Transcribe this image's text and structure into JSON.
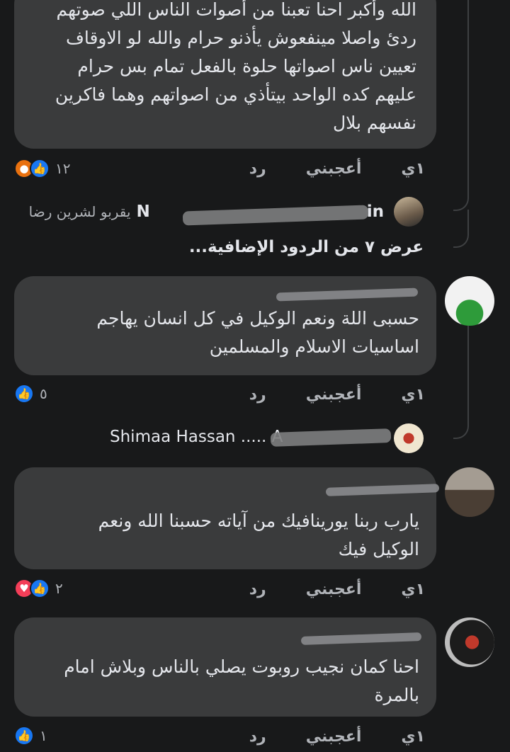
{
  "comments": [
    {
      "text": "الله وأكبر احنا تعبنا من أصوات الناس اللي صوتهم\nردئ واصلا مينفعوش يأذنو حرام والله لو الاوقاف\nتعيين ناس اصواتها حلوة بالفعل تمام بس حرام\nعليهم كده الواحد بيتأذي من اصواتهم وهما فاكرين\nنفسهم بلال",
      "time": "١ي",
      "like": "أعجبني",
      "reply": "رد",
      "reactions": [
        "angry",
        "like"
      ],
      "count": "١٢"
    },
    {
      "text": "حسبى اللة ونعم الوكيل في كل انسان يهاجم\nاساسيات الاسلام والمسلمين",
      "time": "١ي",
      "like": "أعجبني",
      "reply": "رد",
      "reactions": [
        "like"
      ],
      "count": "٥"
    },
    {
      "text": "يارب ربنا يورينافيك من آياته حسبنا الله ونعم\nالوكيل فيك",
      "time": "١ي",
      "like": "أعجبني",
      "reply": "رد",
      "reactions": [
        "love",
        "like"
      ],
      "count": "٢"
    },
    {
      "text": "احنا كمان نجيب روبوت يصلي بالناس وبلاش امام\nبالمرة",
      "time": "١ي",
      "like": "أعجبني",
      "reply": "رد",
      "reactions": [
        "like"
      ],
      "count": "١"
    }
  ],
  "replies": [
    {
      "name_prefix": "N",
      "name_suffix": "in",
      "snippet": "يقربو لشرين رضا"
    },
    {
      "name_prefix": "Shimaa Hassan ..... A",
      "name_suffix": "",
      "snippet": ""
    }
  ],
  "view_more": "عرض ٧ من الردود الإضافية...",
  "icons": {
    "like": "thumbs-up-icon",
    "love": "heart-icon",
    "angry": "angry-face-icon"
  },
  "colors": {
    "background": "#18191a",
    "bubble": "#3a3b3c",
    "like": "#1877f2",
    "love": "#f33e58",
    "angry": "#e9710f"
  }
}
